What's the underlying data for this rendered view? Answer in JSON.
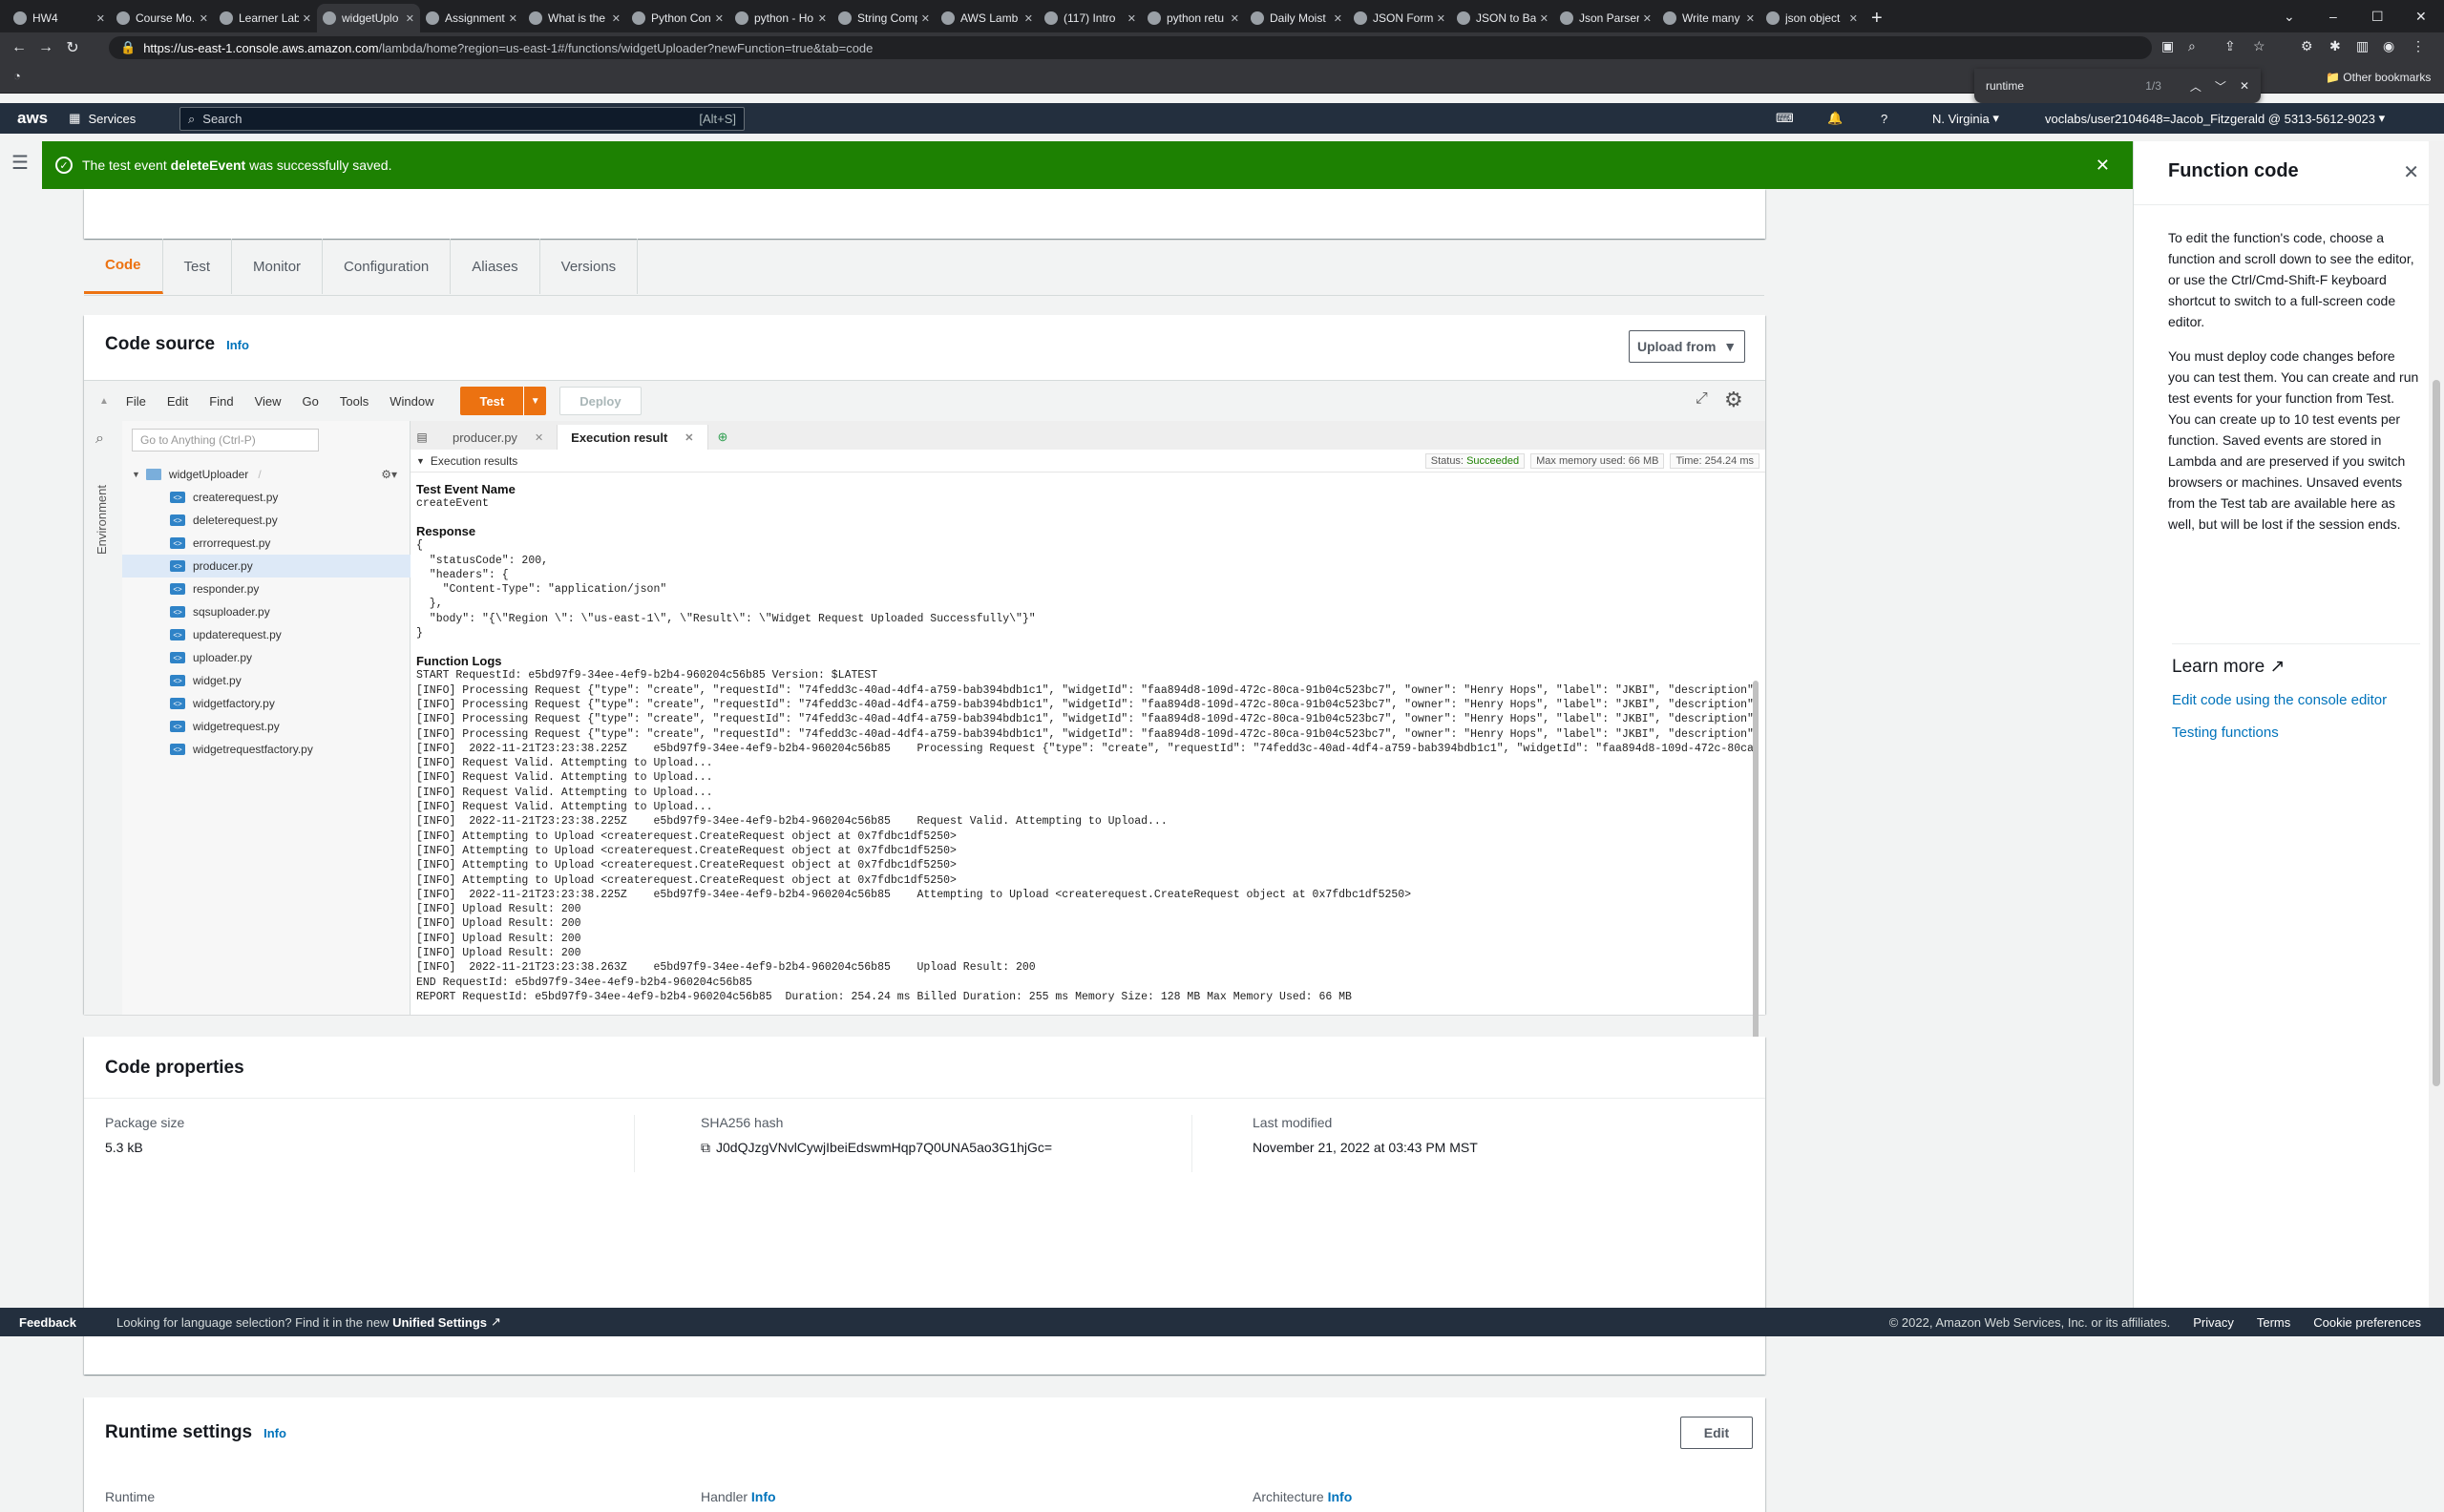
{
  "browser": {
    "tabs": [
      {
        "label": "HW4",
        "icon": "github-icon"
      },
      {
        "label": "Course Mo...",
        "icon": "course-icon"
      },
      {
        "label": "Learner Lab",
        "icon": "lab-icon"
      },
      {
        "label": "widgetUplo",
        "icon": "aws-icon"
      },
      {
        "label": "Assignment",
        "icon": "course-icon"
      },
      {
        "label": "What is the",
        "icon": "reddit-icon"
      },
      {
        "label": "Python Con",
        "icon": "python-icon"
      },
      {
        "label": "python - Ho",
        "icon": "stack-icon"
      },
      {
        "label": "String Comp",
        "icon": "gfg-icon"
      },
      {
        "label": "AWS Lamb",
        "icon": "aws-icon"
      },
      {
        "label": "(117) Intro",
        "icon": "youtube-icon"
      },
      {
        "label": "python retu",
        "icon": "google-icon"
      },
      {
        "label": "Daily Moist",
        "icon": "bookmark-icon"
      },
      {
        "label": "JSON Form",
        "icon": "check-icon"
      },
      {
        "label": "JSON to Ba",
        "icon": "code-icon"
      },
      {
        "label": "Json Parser",
        "icon": "json-icon"
      },
      {
        "label": "Write many",
        "icon": "quill-icon"
      },
      {
        "label": "json object",
        "icon": "google-icon"
      }
    ],
    "url_host": "https://us-east-1.console.aws.amazon.com",
    "url_path": "/lambda/home?region=us-east-1#/functions/widgetUploader?newFunction=true&tab=code",
    "find_query": "runtime",
    "find_count": "1/3",
    "other_bookmarks": "Other bookmarks"
  },
  "aws_nav": {
    "logo": "aws",
    "services": "Services",
    "search_placeholder": "Search",
    "search_shortcut": "[Alt+S]",
    "region": "N. Virginia",
    "account": "voclabs/user2104648=Jacob_Fitzgerald @ 5313-5612-9023"
  },
  "flash": {
    "prefix": "The test event ",
    "event_name": "deleteEvent",
    "suffix": " was successfully saved."
  },
  "tabs": [
    "Code",
    "Test",
    "Monitor",
    "Configuration",
    "Aliases",
    "Versions"
  ],
  "code_source": {
    "title": "Code source",
    "info": "Info",
    "upload_from": "Upload from",
    "menu": [
      "File",
      "Edit",
      "Find",
      "View",
      "Go",
      "Tools",
      "Window"
    ],
    "test": "Test",
    "deploy": "Deploy",
    "goto_placeholder": "Go to Anything (Ctrl-P)",
    "environment": "Environment",
    "folder": "widgetUploader",
    "folder_sep": "/",
    "files": [
      "createrequest.py",
      "deleterequest.py",
      "errorrequest.py",
      "producer.py",
      "responder.py",
      "sqsuploader.py",
      "updaterequest.py",
      "uploader.py",
      "widget.py",
      "widgetfactory.py",
      "widgetrequest.py",
      "widgetrequestfactory.py"
    ],
    "editor_tabs": [
      "producer.py",
      "Execution result"
    ],
    "execution_results": "Execution results",
    "status_label": "Status:",
    "status_value": "Succeeded",
    "max_memory": "Max memory used: 66 MB",
    "time": "Time: 254.24 ms",
    "test_event_name_label": "Test Event Name",
    "test_event_name": "createEvent",
    "response_label": "Response",
    "response_lines": [
      "{",
      "  \"statusCode\": 200,",
      "  \"headers\": {",
      "    \"Content-Type\": \"application/json\"",
      "  },",
      "  \"body\": \"{\\\"Region \\\": \\\"us-east-1\\\", \\\"Result\\\": \\\"Widget Request Uploaded Successfully\\\"}\"",
      "}"
    ],
    "function_logs_label": "Function Logs",
    "log_lines": [
      "START RequestId: e5bd97f9-34ee-4ef9-b2b4-960204c56b85 Version: $LATEST",
      "[INFO] Processing Request {\"type\": \"create\", \"requestId\": \"74fedd3c-40ad-4df4-a759-bab394bdb1c1\", \"widgetId\": \"faa894d8-109d-472c-80ca-91b04c523bc7\", \"owner\": \"Henry Hops\", \"label\": \"JKBI\", \"description\":",
      "[INFO] Processing Request {\"type\": \"create\", \"requestId\": \"74fedd3c-40ad-4df4-a759-bab394bdb1c1\", \"widgetId\": \"faa894d8-109d-472c-80ca-91b04c523bc7\", \"owner\": \"Henry Hops\", \"label\": \"JKBI\", \"description\":",
      "[INFO] Processing Request {\"type\": \"create\", \"requestId\": \"74fedd3c-40ad-4df4-a759-bab394bdb1c1\", \"widgetId\": \"faa894d8-109d-472c-80ca-91b04c523bc7\", \"owner\": \"Henry Hops\", \"label\": \"JKBI\", \"description\":",
      "[INFO] Processing Request {\"type\": \"create\", \"requestId\": \"74fedd3c-40ad-4df4-a759-bab394bdb1c1\", \"widgetId\": \"faa894d8-109d-472c-80ca-91b04c523bc7\", \"owner\": \"Henry Hops\", \"label\": \"JKBI\", \"description\":",
      "[INFO]  2022-11-21T23:23:38.225Z    e5bd97f9-34ee-4ef9-b2b4-960204c56b85    Processing Request {\"type\": \"create\", \"requestId\": \"74fedd3c-40ad-4df4-a759-bab394bdb1c1\", \"widgetId\": \"faa894d8-109d-472c-80ca-",
      "[INFO] Request Valid. Attempting to Upload...",
      "[INFO] Request Valid. Attempting to Upload...",
      "[INFO] Request Valid. Attempting to Upload...",
      "[INFO] Request Valid. Attempting to Upload...",
      "[INFO]  2022-11-21T23:23:38.225Z    e5bd97f9-34ee-4ef9-b2b4-960204c56b85    Request Valid. Attempting to Upload...",
      "[INFO] Attempting to Upload <createrequest.CreateRequest object at 0x7fdbc1df5250>",
      "[INFO] Attempting to Upload <createrequest.CreateRequest object at 0x7fdbc1df5250>",
      "[INFO] Attempting to Upload <createrequest.CreateRequest object at 0x7fdbc1df5250>",
      "[INFO] Attempting to Upload <createrequest.CreateRequest object at 0x7fdbc1df5250>",
      "[INFO]  2022-11-21T23:23:38.225Z    e5bd97f9-34ee-4ef9-b2b4-960204c56b85    Attempting to Upload <createrequest.CreateRequest object at 0x7fdbc1df5250>",
      "[INFO] Upload Result: 200",
      "[INFO] Upload Result: 200",
      "[INFO] Upload Result: 200",
      "[INFO] Upload Result: 200",
      "[INFO]  2022-11-21T23:23:38.263Z    e5bd97f9-34ee-4ef9-b2b4-960204c56b85    Upload Result: 200",
      "END RequestId: e5bd97f9-34ee-4ef9-b2b4-960204c56b85",
      "REPORT RequestId: e5bd97f9-34ee-4ef9-b2b4-960204c56b85  Duration: 254.24 ms Billed Duration: 255 ms Memory Size: 128 MB Max Memory Used: 66 MB"
    ]
  },
  "code_properties": {
    "title": "Code properties",
    "package_size_label": "Package size",
    "package_size": "5.3 kB",
    "sha_label": "SHA256 hash",
    "sha": "J0dQJzgVNvlCywjIbeiEdswmHqp7Q0UNA5ao3G1hjGc=",
    "modified_label": "Last modified",
    "modified": "November 21, 2022 at 03:43 PM MST"
  },
  "runtime_settings": {
    "title": "Runtime settings",
    "info": "Info",
    "edit": "Edit",
    "col1": "Runtime",
    "col2": "Handler",
    "col2_info": "Info",
    "col3": "Architecture",
    "col3_info": "Info"
  },
  "help": {
    "title": "Function code",
    "p1": "To edit the function's code, choose a function and scroll down to see the editor, or use the Ctrl/Cmd-Shift-F keyboard shortcut to switch to a full-screen code editor.",
    "p2": "You must deploy code changes before you can test them. You can create and run test events for your function from Test. You can create up to 10 test events per function. Saved events are stored in Lambda and are preserved if you switch browsers or machines. Unsaved events from the Test tab are available here as well, but will be lost if the session ends.",
    "learn_more": "Learn more",
    "links": [
      "Edit code using the console editor",
      "Testing functions"
    ]
  },
  "footer": {
    "feedback": "Feedback",
    "notice": "Looking for language selection? Find it in the new ",
    "unified": "Unified Settings",
    "copyright": "© 2022, Amazon Web Services, Inc. or its affiliates.",
    "privacy": "Privacy",
    "terms": "Terms",
    "cookies": "Cookie preferences"
  },
  "colors": {
    "accent": "#ec7211",
    "success": "#1d8102",
    "nav": "#232f3e",
    "link": "#0073bb"
  }
}
